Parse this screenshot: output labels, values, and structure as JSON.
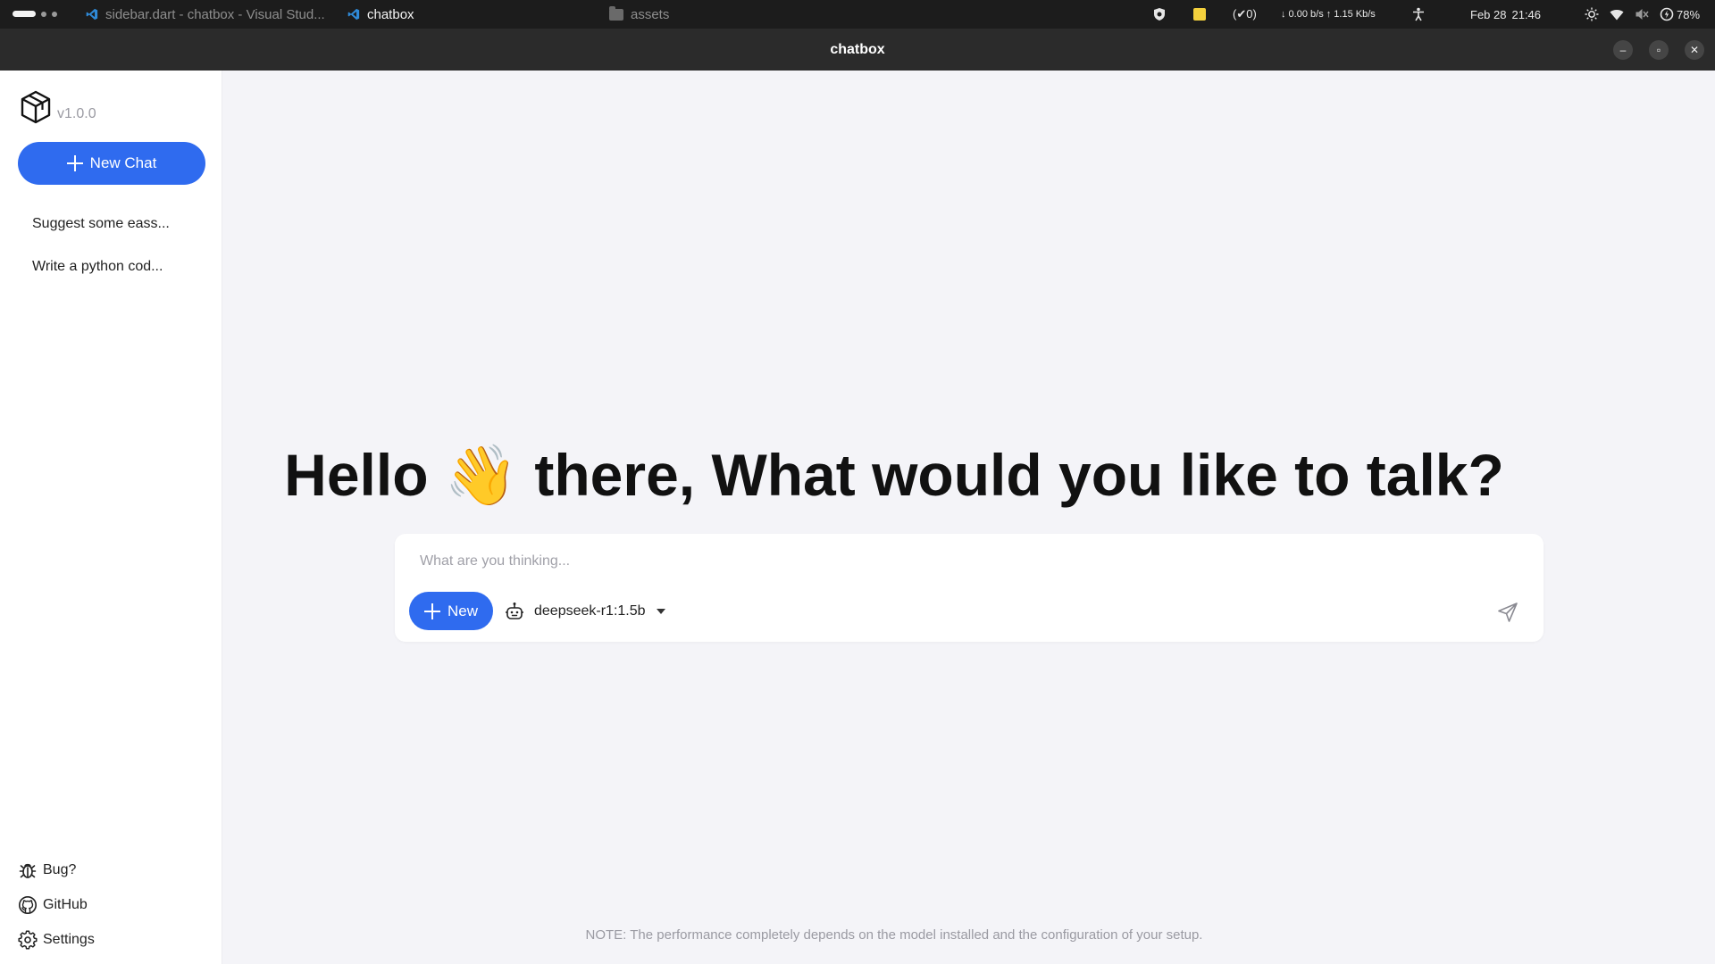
{
  "system_bar": {
    "tasks": [
      {
        "label": "sidebar.dart - chatbox - Visual Stud...",
        "active": false
      },
      {
        "label": "chatbox",
        "active": true
      },
      {
        "label": "assets",
        "active": false
      }
    ],
    "updates": "(✔0)",
    "network": "↓ 0.00 b/s ↑ 1.15 Kb/s",
    "date": "Feb 28",
    "time": "21:46",
    "battery": "78%"
  },
  "window": {
    "title": "chatbox",
    "minimize": "–",
    "restore": "▫",
    "close": "✕"
  },
  "sidebar": {
    "version": "v1.0.0",
    "new_chat_label": "New Chat",
    "history": [
      {
        "label": "Suggest some eass..."
      },
      {
        "label": "Write a python cod..."
      }
    ],
    "bottom": [
      {
        "label": "Bug?",
        "icon": "bug-icon"
      },
      {
        "label": "GitHub",
        "icon": "github-icon"
      },
      {
        "label": "Settings",
        "icon": "gear-icon"
      }
    ]
  },
  "main": {
    "greeting": "Hello 👋 there, What would you like to talk?",
    "composer": {
      "placeholder": "What are you thinking...",
      "value": "",
      "new_label": "New",
      "model": "deepseek-r1:1.5b"
    },
    "note": "NOTE: The performance completely depends on the model installed and the configuration of your setup."
  },
  "colors": {
    "accent": "#2f6bef",
    "background": "#f4f4f8",
    "sidebar": "#ffffff",
    "titlebar": "#2b2b2b",
    "systembar": "#1c1c1c"
  }
}
